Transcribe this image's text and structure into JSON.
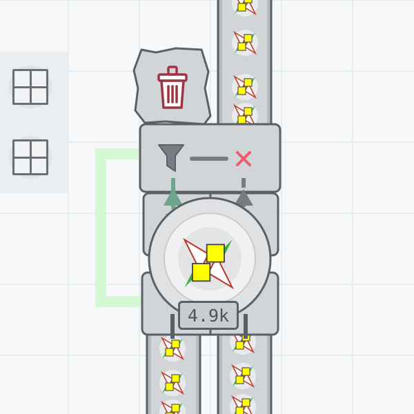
{
  "machine": {
    "throughput_label": "4.9k",
    "filter_icon": "funnel-icon",
    "reject_icon": "x-icon",
    "delete_icon": "trash-icon",
    "item_icon": "shape-item-icon",
    "colors": {
      "item_yellow": "#ffff00",
      "item_green": "#3cb043",
      "item_red": "#c0392b",
      "reject_red": "#ef5b6b",
      "filter_accent": "#6ea68d",
      "trash_red": "#a0343f",
      "frame": "#5b6068"
    }
  },
  "toolbar": {
    "slots": [
      {
        "icon": "grid-slot-icon"
      },
      {
        "icon": "grid-slot-icon"
      }
    ]
  }
}
